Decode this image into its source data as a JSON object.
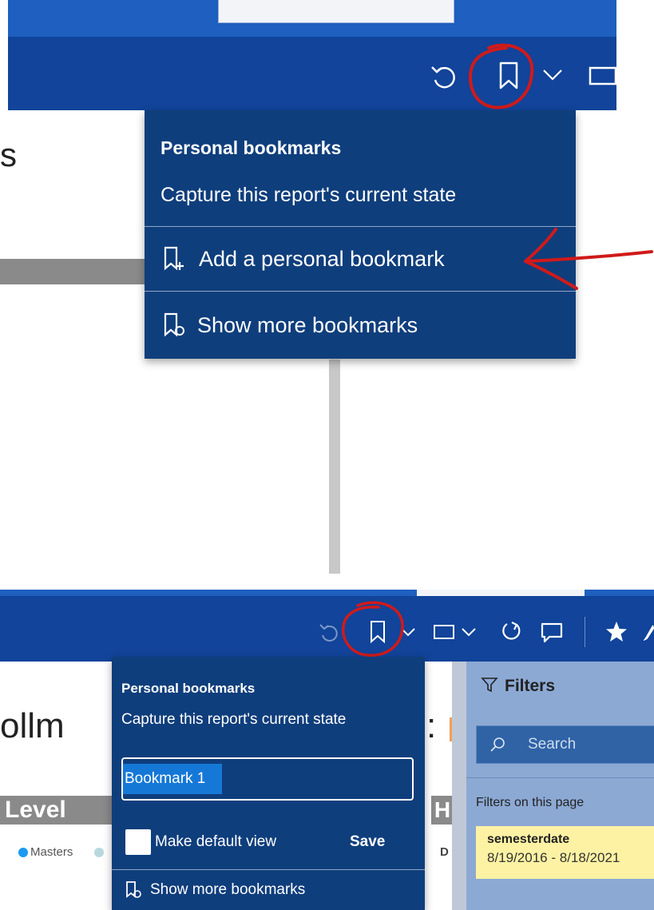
{
  "top": {
    "menu": {
      "title": "Personal bookmarks",
      "subtitle": "Capture this report's current state",
      "add_label": "Add a personal bookmark",
      "show_more_label": "Show more bookmarks"
    },
    "partial_heading": "s"
  },
  "bottom": {
    "menu": {
      "title": "Personal bookmarks",
      "subtitle": "Capture this report's current state",
      "input_value": "Bookmark 1",
      "checkbox_label": "Make default view",
      "save_label": "Save",
      "show_more_label": "Show more bookmarks"
    },
    "report": {
      "title_fragment": "ollm",
      "title_colon": ":",
      "level_badge": "Level",
      "h_badge": "H",
      "legend_masters": "Masters",
      "legend_d": "D"
    },
    "filters": {
      "title": "Filters",
      "search_placeholder": "Search",
      "section_label": "Filters on this page",
      "card_field": "semesterdate",
      "card_value": "8/19/2016 - 8/18/2021"
    }
  },
  "colors": {
    "toolbar": "#11449a",
    "menu": "#0f3e7c",
    "annotation": "#d11a1a",
    "filter_pane": "#8ca9d4",
    "filter_card": "#fdf2a3"
  },
  "icons": [
    "undo-icon",
    "bookmark-icon",
    "chevron-down-icon",
    "view-icon",
    "refresh-icon",
    "comment-icon",
    "star-icon",
    "filter-icon",
    "search-icon",
    "bookmark-add-icon",
    "bookmarks-show-icon"
  ]
}
